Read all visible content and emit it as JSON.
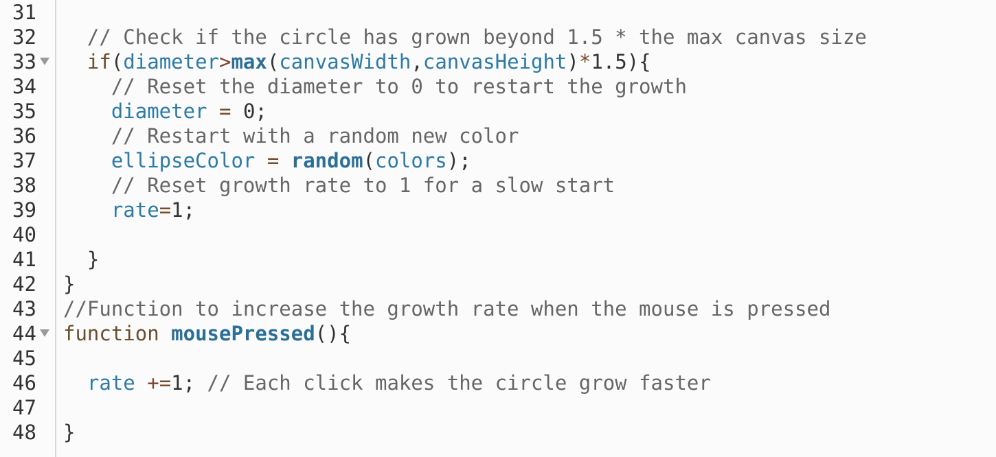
{
  "editor": {
    "lines": [
      {
        "num": "31",
        "fold": false,
        "indent": 0,
        "tokens": []
      },
      {
        "num": "32",
        "fold": false,
        "indent": 1,
        "tokens": [
          {
            "t": "cm",
            "v": "// Check if the circle has grown beyond 1.5 * the max canvas size"
          }
        ]
      },
      {
        "num": "33",
        "fold": true,
        "indent": 1,
        "tokens": [
          {
            "t": "kw",
            "v": "if"
          },
          {
            "t": "pn",
            "v": "("
          },
          {
            "t": "vr",
            "v": "diameter"
          },
          {
            "t": "op",
            "v": ">"
          },
          {
            "t": "fn",
            "v": "max"
          },
          {
            "t": "pn",
            "v": "("
          },
          {
            "t": "vr",
            "v": "canvasWidth"
          },
          {
            "t": "pn",
            "v": ","
          },
          {
            "t": "vr",
            "v": "canvasHeight"
          },
          {
            "t": "pn",
            "v": ")"
          },
          {
            "t": "op",
            "v": "*"
          },
          {
            "t": "nm",
            "v": "1.5"
          },
          {
            "t": "pn",
            "v": "){"
          }
        ]
      },
      {
        "num": "34",
        "fold": false,
        "indent": 2,
        "tokens": [
          {
            "t": "cm",
            "v": "// Reset the diameter to 0 to restart the growth"
          }
        ]
      },
      {
        "num": "35",
        "fold": false,
        "indent": 2,
        "tokens": [
          {
            "t": "vr",
            "v": "diameter"
          },
          {
            "t": "pn",
            "v": " "
          },
          {
            "t": "op",
            "v": "="
          },
          {
            "t": "pn",
            "v": " "
          },
          {
            "t": "nm",
            "v": "0"
          },
          {
            "t": "pn",
            "v": ";"
          }
        ]
      },
      {
        "num": "36",
        "fold": false,
        "indent": 2,
        "tokens": [
          {
            "t": "cm",
            "v": "// Restart with a random new color"
          }
        ]
      },
      {
        "num": "37",
        "fold": false,
        "indent": 2,
        "tokens": [
          {
            "t": "vr",
            "v": "ellipseColor"
          },
          {
            "t": "pn",
            "v": " "
          },
          {
            "t": "op",
            "v": "="
          },
          {
            "t": "pn",
            "v": " "
          },
          {
            "t": "fn",
            "v": "random"
          },
          {
            "t": "pn",
            "v": "("
          },
          {
            "t": "vr",
            "v": "colors"
          },
          {
            "t": "pn",
            "v": ");"
          }
        ]
      },
      {
        "num": "38",
        "fold": false,
        "indent": 2,
        "tokens": [
          {
            "t": "cm",
            "v": "// Reset growth rate to 1 for a slow start"
          }
        ]
      },
      {
        "num": "39",
        "fold": false,
        "indent": 2,
        "tokens": [
          {
            "t": "vr",
            "v": "rate"
          },
          {
            "t": "op",
            "v": "="
          },
          {
            "t": "nm",
            "v": "1"
          },
          {
            "t": "pn",
            "v": ";"
          }
        ]
      },
      {
        "num": "40",
        "fold": false,
        "indent": 0,
        "tokens": []
      },
      {
        "num": "41",
        "fold": false,
        "indent": 1,
        "tokens": [
          {
            "t": "pn",
            "v": "}"
          }
        ]
      },
      {
        "num": "42",
        "fold": false,
        "indent": 0,
        "tokens": [
          {
            "t": "pn",
            "v": "}"
          }
        ]
      },
      {
        "num": "43",
        "fold": false,
        "indent": 0,
        "tokens": [
          {
            "t": "cm",
            "v": "//Function to increase the growth rate when the mouse is pressed"
          }
        ]
      },
      {
        "num": "44",
        "fold": true,
        "indent": 0,
        "tokens": [
          {
            "t": "kw",
            "v": "function"
          },
          {
            "t": "pn",
            "v": " "
          },
          {
            "t": "fn",
            "v": "mousePressed"
          },
          {
            "t": "pn",
            "v": "(){"
          }
        ]
      },
      {
        "num": "45",
        "fold": false,
        "indent": 0,
        "tokens": []
      },
      {
        "num": "46",
        "fold": false,
        "indent": 1,
        "tokens": [
          {
            "t": "vr",
            "v": "rate"
          },
          {
            "t": "pn",
            "v": " "
          },
          {
            "t": "op",
            "v": "+="
          },
          {
            "t": "nm",
            "v": "1"
          },
          {
            "t": "pn",
            "v": "; "
          },
          {
            "t": "cm",
            "v": "// Each click makes the circle grow faster"
          }
        ]
      },
      {
        "num": "47",
        "fold": false,
        "indent": 0,
        "tokens": []
      },
      {
        "num": "48",
        "fold": false,
        "indent": 0,
        "tokens": [
          {
            "t": "pn",
            "v": "}"
          }
        ]
      }
    ],
    "colors": {
      "background": "#fbfbfb",
      "comment": "#666666",
      "keyword": "#6b4e2e",
      "variable": "#2c7aa6",
      "function": "#2c6f96",
      "gutter_border": "#d8d8d8"
    },
    "icons": {
      "fold": "fold-arrow-icon"
    }
  }
}
